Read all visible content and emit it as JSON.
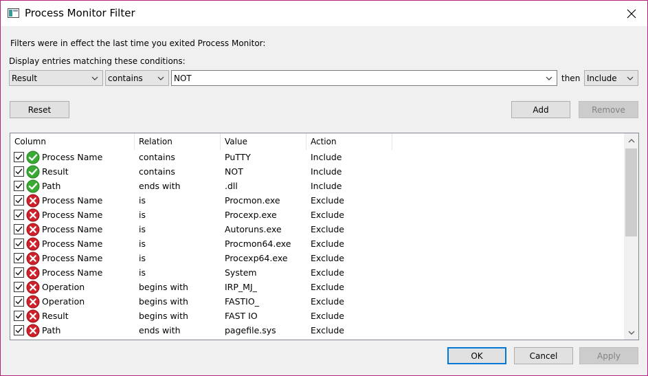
{
  "window": {
    "title": "Process Monitor Filter"
  },
  "info_text": "Filters were in effect the last time you exited Process Monitor:",
  "conditions_label": "Display entries matching these conditions:",
  "filter_row": {
    "column": "Result",
    "relation": "contains",
    "value": "NOT",
    "then_label": "then",
    "action": "Include"
  },
  "buttons": {
    "reset": "Reset",
    "add": "Add",
    "remove": "Remove",
    "ok": "OK",
    "cancel": "Cancel",
    "apply": "Apply"
  },
  "table": {
    "headers": [
      "Column",
      "Relation",
      "Value",
      "Action"
    ],
    "rows": [
      {
        "column": "Process Name",
        "relation": "contains",
        "value": "PuTTY",
        "action": "Include",
        "status": "include"
      },
      {
        "column": "Result",
        "relation": "contains",
        "value": "NOT",
        "action": "Include",
        "status": "include"
      },
      {
        "column": "Path",
        "relation": "ends with",
        "value": ".dll",
        "action": "Include",
        "status": "include"
      },
      {
        "column": "Process Name",
        "relation": "is",
        "value": "Procmon.exe",
        "action": "Exclude",
        "status": "exclude"
      },
      {
        "column": "Process Name",
        "relation": "is",
        "value": "Procexp.exe",
        "action": "Exclude",
        "status": "exclude"
      },
      {
        "column": "Process Name",
        "relation": "is",
        "value": "Autoruns.exe",
        "action": "Exclude",
        "status": "exclude"
      },
      {
        "column": "Process Name",
        "relation": "is",
        "value": "Procmon64.exe",
        "action": "Exclude",
        "status": "exclude"
      },
      {
        "column": "Process Name",
        "relation": "is",
        "value": "Procexp64.exe",
        "action": "Exclude",
        "status": "exclude"
      },
      {
        "column": "Process Name",
        "relation": "is",
        "value": "System",
        "action": "Exclude",
        "status": "exclude"
      },
      {
        "column": "Operation",
        "relation": "begins with",
        "value": "IRP_MJ_",
        "action": "Exclude",
        "status": "exclude"
      },
      {
        "column": "Operation",
        "relation": "begins with",
        "value": "FASTIO_",
        "action": "Exclude",
        "status": "exclude"
      },
      {
        "column": "Result",
        "relation": "begins with",
        "value": "FAST IO",
        "action": "Exclude",
        "status": "exclude"
      },
      {
        "column": "Path",
        "relation": "ends with",
        "value": "pagefile.sys",
        "action": "Exclude",
        "status": "exclude"
      }
    ]
  },
  "colors": {
    "title_border": "#b4217a",
    "include_green": "#3aaa35",
    "exclude_red": "#d0202a",
    "focus_blue": "#0078d7"
  }
}
